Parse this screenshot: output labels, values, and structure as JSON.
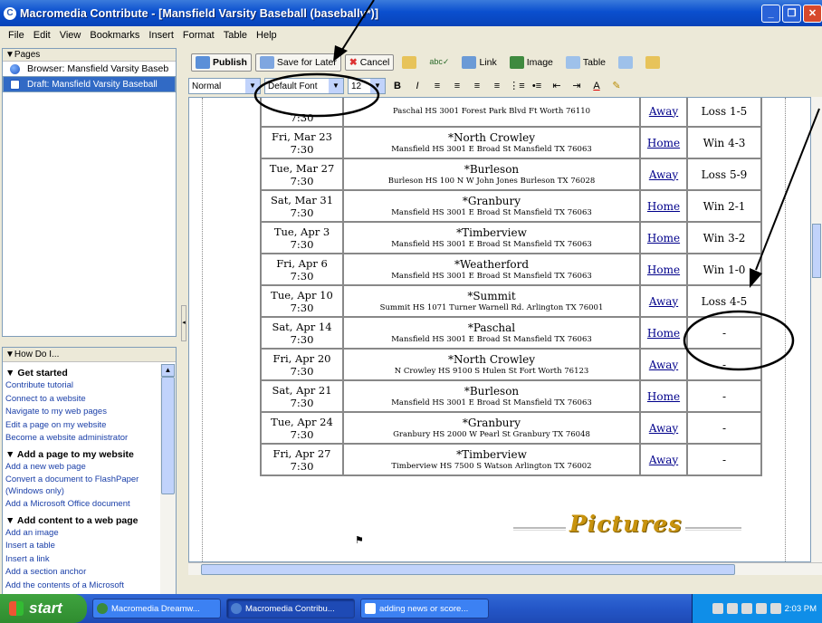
{
  "window": {
    "title": "Macromedia Contribute - [Mansfield Varsity Baseball (baseballv*)]"
  },
  "menu": [
    "File",
    "Edit",
    "View",
    "Bookmarks",
    "Insert",
    "Format",
    "Table",
    "Help"
  ],
  "pages_panel": {
    "header": "Pages",
    "items": [
      {
        "label": "Browser: Mansfield Varsity Baseb",
        "icon": "globe-icon"
      },
      {
        "label": "Draft: Mansfield Varsity Baseball",
        "icon": "draft-page-icon",
        "selected": true
      }
    ]
  },
  "howdoi": {
    "header": "How Do I...",
    "groups": [
      {
        "title": "Get started",
        "links": [
          "Contribute tutorial",
          "Connect to a website",
          "Navigate to my web pages",
          "Edit a page on my website",
          "Become a website administrator"
        ]
      },
      {
        "title": "Add a page to my website",
        "links": [
          "Add a new web page",
          "Convert a document to FlashPaper (Windows only)",
          "Add a Microsoft Office document"
        ]
      },
      {
        "title": "Add content to a web page",
        "links": [
          "Add an image",
          "Insert a table",
          "Insert a link",
          "Add a section anchor",
          "Add the contents of a Microsoft"
        ]
      }
    ]
  },
  "toolbar": {
    "publish": "Publish",
    "save_for_later": "Save for Later",
    "cancel": "Cancel",
    "link": "Link",
    "image": "Image",
    "table": "Table"
  },
  "format_bar": {
    "style": "Normal",
    "font": "Default Font",
    "size": "12"
  },
  "schedule": [
    {
      "date": "",
      "time": "7:30",
      "opponent": "",
      "location": "Paschal HS 3001 Forest Park Blvd Ft Worth 76110",
      "venue": "Away",
      "result": "Loss 1-5"
    },
    {
      "date": "Fri, Mar 23",
      "time": "7:30",
      "opponent": "*North Crowley",
      "location": "Mansfield HS 3001 E Broad St Mansfield TX 76063",
      "venue": "Home",
      "result": "Win 4-3"
    },
    {
      "date": "Tue, Mar 27",
      "time": "7:30",
      "opponent": "*Burleson",
      "location": "Burleson HS 100 N W John Jones Burleson TX 76028",
      "venue": "Away",
      "result": "Loss 5-9"
    },
    {
      "date": "Sat, Mar 31",
      "time": "7:30",
      "opponent": "*Granbury",
      "location": "Mansfield HS 3001 E Broad St Mansfield TX 76063",
      "venue": "Home",
      "result": "Win 2-1"
    },
    {
      "date": "Tue, Apr 3",
      "time": "7:30",
      "opponent": "*Timberview",
      "location": "Mansfield HS 3001 E Broad St Mansfield TX 76063",
      "venue": "Home",
      "result": "Win 3-2"
    },
    {
      "date": "Fri, Apr 6",
      "time": "7:30",
      "opponent": "*Weatherford",
      "location": "Mansfield HS 3001 E Broad St Mansfield TX 76063",
      "venue": "Home",
      "result": "Win 1-0"
    },
    {
      "date": "Tue, Apr 10",
      "time": "7:30",
      "opponent": "*Summit",
      "location": "Summit HS 1071 Turner Warnell Rd. Arlington TX 76001",
      "venue": "Away",
      "result": "Loss 4-5"
    },
    {
      "date": "Sat, Apr 14",
      "time": "7:30",
      "opponent": "*Paschal",
      "location": "Mansfield HS 3001 E Broad St Mansfield TX 76063",
      "venue": "Home",
      "result": "-"
    },
    {
      "date": "Fri, Apr 20",
      "time": "7:30",
      "opponent": "*North Crowley",
      "location": "N Crowley HS 9100 S Hulen St Fort Worth 76123",
      "venue": "Away",
      "result": "-"
    },
    {
      "date": "Sat, Apr 21",
      "time": "7:30",
      "opponent": "*Burleson",
      "location": "Mansfield HS 3001 E Broad St Mansfield TX 76063",
      "venue": "Home",
      "result": "-"
    },
    {
      "date": "Tue, Apr 24",
      "time": "7:30",
      "opponent": "*Granbury",
      "location": "Granbury HS 2000 W Pearl St Granbury TX 76048",
      "venue": "Away",
      "result": "-"
    },
    {
      "date": "Fri, Apr 27",
      "time": "7:30",
      "opponent": "*Timberview",
      "location": "Timberview HS 7500 S Watson Arlington TX 76002",
      "venue": "Away",
      "result": "-"
    }
  ],
  "pictures_heading": "Pictures",
  "taskbar": {
    "start": "start",
    "tasks": [
      "Macromedia Dreamw...",
      "Macromedia Contribu...",
      "adding news or score..."
    ],
    "clock": "2:03 PM"
  }
}
